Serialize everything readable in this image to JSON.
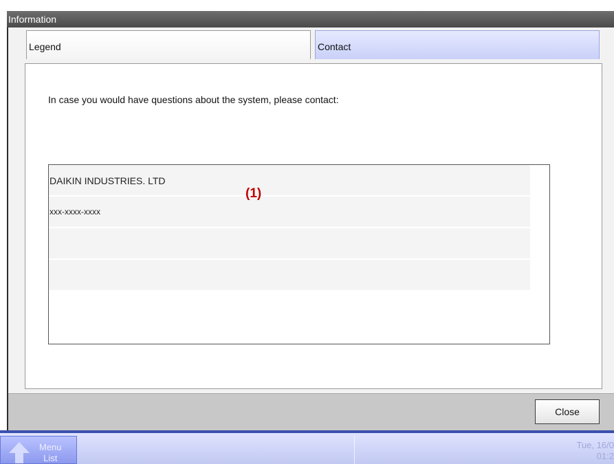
{
  "window": {
    "title": "Information"
  },
  "tabs": [
    {
      "label": "Legend"
    },
    {
      "label": "Contact"
    }
  ],
  "content": {
    "instruction": "In case you would have questions about the system, please contact:",
    "rows": [
      "DAIKIN INDUSTRIES. LTD",
      "xxx-xxxx-xxxx",
      "",
      ""
    ],
    "callout": "(1)"
  },
  "footer": {
    "close_label": "Close"
  },
  "bottombar": {
    "menu_line1": "Menu",
    "menu_line2": "List",
    "date_line1": "Tue, 16/0",
    "date_line2": "01:2"
  },
  "colors": {
    "tab_active": "#c9d0f8",
    "callout": "#c00000",
    "bar_accent": "#3a4fae"
  }
}
